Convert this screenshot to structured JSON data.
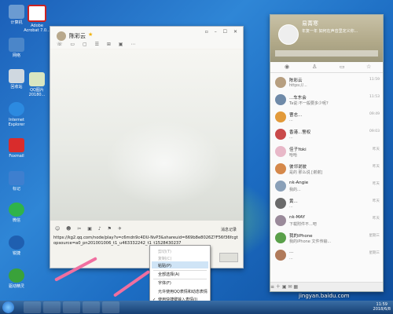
{
  "desktop_icons": [
    {
      "label": "计算机"
    },
    {
      "label": "Adobe Acrobat 7.0..."
    },
    {
      "label": "网络"
    },
    {
      "label": "回收站"
    },
    {
      "label": "QQ图片20180..."
    },
    {
      "label": "Internet Explorer"
    },
    {
      "label": "Foxmail"
    },
    {
      "label": "标记"
    },
    {
      "label": "微信"
    },
    {
      "label": "锐捷"
    },
    {
      "label": "驱动精灵"
    }
  ],
  "chat": {
    "contact_name": "陈彩云",
    "history_label": "消息记录",
    "input_text": "https://kg2.qq.com/node/play?s=c6mdn9c4DU-NvP3&shareuid=669b8e8026Z?F56f36fcgtopsource=a0_pn201001006_t1_u463332242_t1_t1528430237",
    "send_label": "发送"
  },
  "context_menu": {
    "items": [
      "剪切(T)",
      "复制(C)",
      "粘贴(P)",
      "全部选择(A)",
      "字体(F)",
      "允许使用QQ表情和动态表情",
      "使用快捷键输入表情(J)"
    ],
    "disabled": [
      true,
      true,
      false,
      false,
      false,
      false,
      false
    ],
    "highlighted_index": 2,
    "checked_index": 6
  },
  "contacts_panel": {
    "user_name": "易菁寒",
    "signature": "年复一年  如何在声音里定义你...",
    "contacts": [
      {
        "name": "陈彩云",
        "msg": "https://..."
      },
      {
        "name": "...车东会",
        "msg": "Ta说:不一般要多少呢?"
      },
      {
        "name": "曹志...",
        "msg": "..."
      },
      {
        "name": "香港...警权",
        "msg": "..."
      },
      {
        "name": "佳子Yoki",
        "msg": "哈哈"
      },
      {
        "name": "彼邻说彼",
        "msg": "是的 那么说 [谢谢]"
      },
      {
        "name": "nk-Angie",
        "msg": "我的..."
      },
      {
        "name": "黄...",
        "msg": "..."
      },
      {
        "name": "nk-MAY",
        "msg": "下载附件不...吧"
      },
      {
        "name": "我的iPhone",
        "msg": "我的iPhone 文件传输..."
      },
      {
        "name": "...",
        "msg": "..."
      }
    ],
    "times": [
      "11:59",
      "11:53",
      "09:49",
      "09:03",
      "昨天",
      "昨天",
      "昨天",
      "昨天",
      "昨天",
      "星期三",
      "星期三"
    ]
  },
  "taskbar": {
    "time": "11:59",
    "date": "2018/6/8"
  },
  "watermark": "jingyan.baidu.com"
}
